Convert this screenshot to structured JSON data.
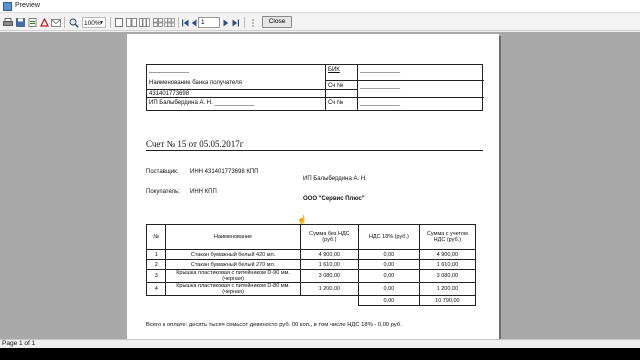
{
  "window": {
    "title": "Preview"
  },
  "toolbar": {
    "zoom": "100%",
    "page_input": "1",
    "close_label": "Close"
  },
  "status": {
    "page_info": "Page 1 of 1"
  },
  "document": {
    "bank": {
      "blank_top": "____________",
      "bank_name_label": "Наименование банка получателя",
      "bik_label": "БИК",
      "bik_value": "____________",
      "acct_label1": "Сч №",
      "acct_value1": "____________",
      "inn": "431401773698",
      "recipient": "ИП Балыбердина А. Н.  ____________",
      "acct_label2": "Сч №",
      "acct_value2": "____________"
    },
    "title": "Счет № 15 от 05.05.2017г",
    "supplier_label": "Поставщик:",
    "supplier_inn": "ИНН 431401773698  КПП",
    "supplier_name": "ИП Балыбердина А. Н.",
    "buyer_label": "Покупатель:",
    "buyer_inn": "ИНН   КПП",
    "buyer_name": "ООО \"Сервис Плюс\"",
    "table": {
      "headers": [
        "№",
        "Наименование",
        "Сумма без НДС (руб.)",
        "НДС 18% (руб.)",
        "Сумма с учетом НДС (руб.)"
      ],
      "rows": [
        [
          "1",
          "Стакан бумажный белый 420 мл.",
          "4 900,00",
          "0,00",
          "4 900,00"
        ],
        [
          "2",
          "Стакан бумажный белый 270 мл.",
          "1 610,00",
          "0,00",
          "1 610,00"
        ],
        [
          "3",
          "Крышка пластиковая с питейником D-90 мм. (черная)",
          "3 080,00",
          "0,00",
          "3 080,00"
        ],
        [
          "4",
          "Крышка пластиковая с питейником D-80 мм. (черная)",
          "1 200,00",
          "0,00",
          "1 200,00"
        ]
      ],
      "total_vat": "0,00",
      "total_sum": "10 790,00"
    },
    "summary": "Всего к оплате: десять тысяч семьсот девяносто  руб.  00  коп., в том числе НДС 18% - 0,00 руб."
  }
}
